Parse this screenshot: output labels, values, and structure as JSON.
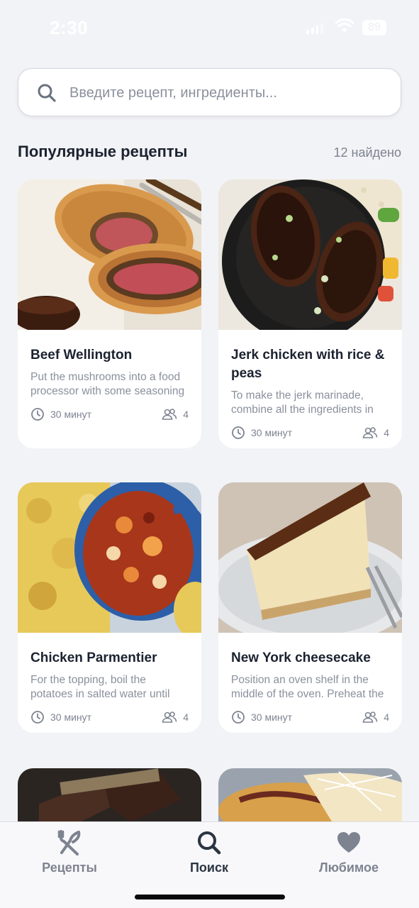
{
  "status_bar": {
    "time": "2:30",
    "battery": "89"
  },
  "search": {
    "placeholder": "Введите рецепт, ингредиенты..."
  },
  "section": {
    "title": "Популярные рецепты",
    "count": "12 найдено"
  },
  "recipes": [
    {
      "title": "Beef Wellington",
      "description": "Put the mushrooms into a food processor with some seasoning",
      "time": "30 минут",
      "servings": "4"
    },
    {
      "title": "Jerk chicken with rice & peas",
      "description": "To make the jerk marinade, combine all the ingredients in",
      "time": "30 минут",
      "servings": "4"
    },
    {
      "title": "Chicken Parmentier",
      "description": "For the topping, boil the potatoes in salted water until",
      "time": "30 минут",
      "servings": "4"
    },
    {
      "title": "New York cheesecake",
      "description": "Position an oven shelf in the middle of the oven. Preheat the",
      "time": "30 минут",
      "servings": "4"
    }
  ],
  "tabs": [
    {
      "label": "Рецепты",
      "icon": "fork-knife-icon",
      "active": false
    },
    {
      "label": "Поиск",
      "icon": "search-icon",
      "active": true
    },
    {
      "label": "Любимое",
      "icon": "heart-icon",
      "active": false
    }
  ],
  "colors": {
    "background": "#f2f3f6",
    "card": "#ffffff",
    "text": "#1b2230",
    "muted": "#8a909c",
    "tab_active": "#2b3441",
    "tab_inactive": "#7d8390"
  }
}
